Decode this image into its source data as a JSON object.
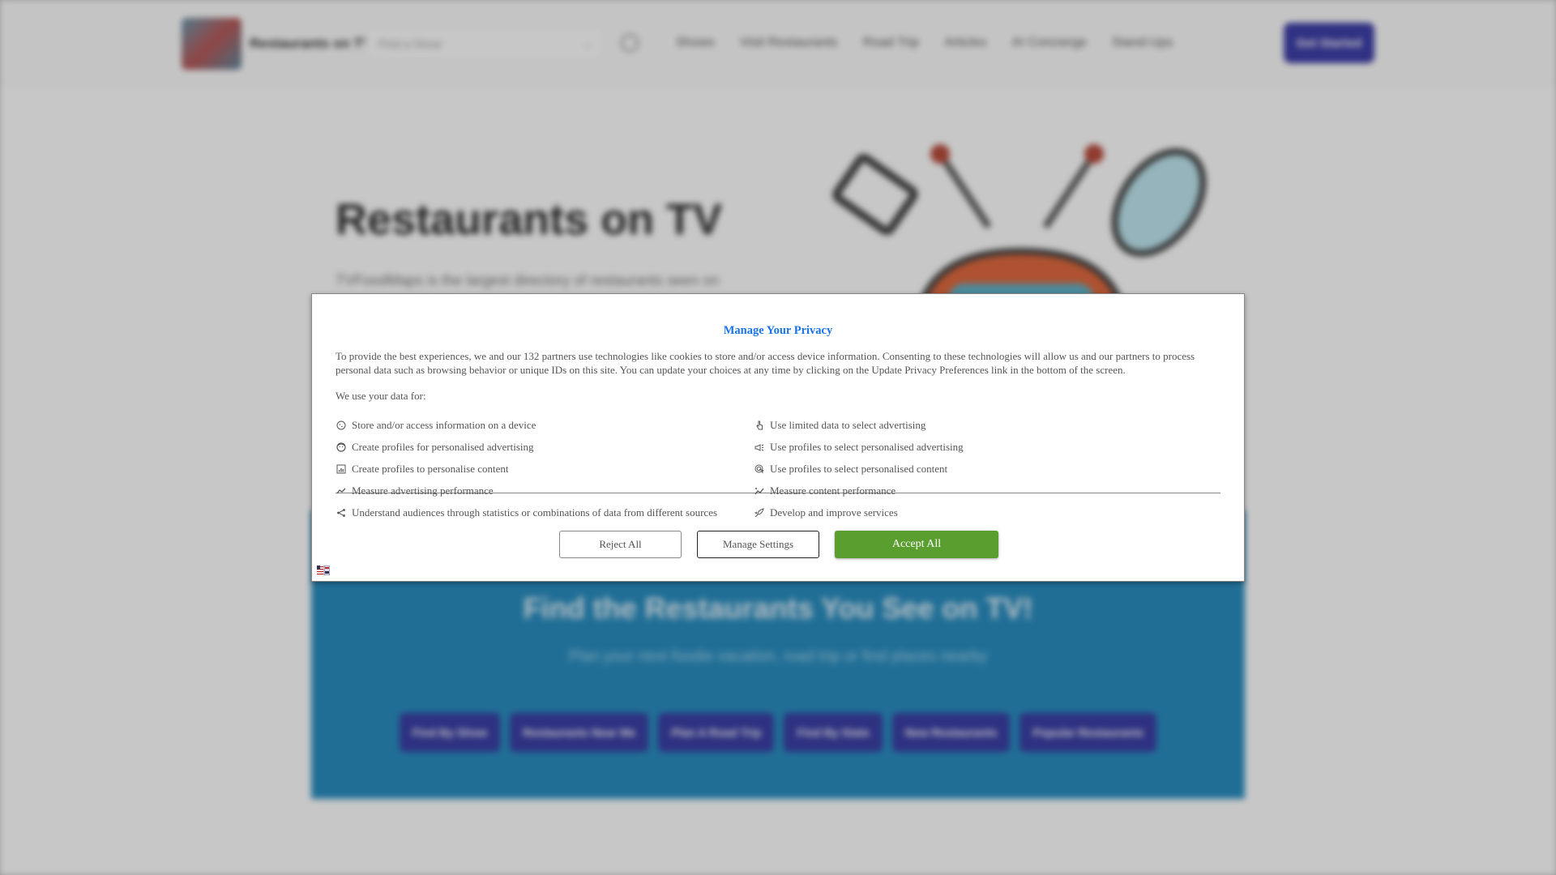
{
  "header": {
    "brand": "Restaurants on TV",
    "search_placeholder": "Find a Show",
    "nav": [
      "Shows",
      "Visit Restaurants",
      "Road Trip",
      "Articles",
      "AI Concierge",
      "Stand-Ups"
    ],
    "cta_label": "Get Started"
  },
  "hero": {
    "title": "Restaurants on TV",
    "subtitle": "TVFoodMaps is the largest directory of restaurants seen on"
  },
  "band": {
    "title": "Find the Restaurants You See on TV!",
    "subtitle": "Plan your next foodie vacation, road trip or find places nearby",
    "buttons": [
      "Find By Show",
      "Restaurants Near Me",
      "Plan A Road Trip",
      "Find By State",
      "New Restaurants",
      "Popular Restaurants"
    ],
    "color": "#2a8ec1"
  },
  "consent": {
    "title": "Manage Your Privacy",
    "description": "To provide the best experiences, we and our 132 partners use technologies like cookies to store and/or access device information. Consenting to these technologies will allow us and our partners to process personal data such as browsing behavior or unique IDs on this site. You can update your choices at any time by clicking on the Update Privacy Preferences link in the bottom of the screen.",
    "uses_label": "We use your data for:",
    "purposes_left": [
      {
        "icon": "cookie-icon",
        "label": "Store and/or access information on a device"
      },
      {
        "icon": "profile-face-icon",
        "label": "Create profiles for personalised advertising"
      },
      {
        "icon": "chart-box-icon",
        "label": "Create profiles to personalise content"
      },
      {
        "icon": "trend-line-icon",
        "label": "Measure advertising performance"
      },
      {
        "icon": "share-icon",
        "label": "Understand audiences through statistics or combinations of data from different sources"
      }
    ],
    "purposes_right": [
      {
        "icon": "pointer-hand-icon",
        "label": "Use limited data to select advertising"
      },
      {
        "icon": "megaphone-icon",
        "label": "Use profiles to select personalised advertising"
      },
      {
        "icon": "target-cursor-icon",
        "label": "Use profiles to select personalised content"
      },
      {
        "icon": "sparkle-trend-icon",
        "label": "Measure content performance"
      },
      {
        "icon": "rocket-icon",
        "label": "Develop and improve services"
      }
    ],
    "buttons": {
      "reject": "Reject All",
      "manage": "Manage Settings",
      "accept": "Accept All"
    },
    "title_color": "#1a73e8",
    "accept_color": "#5a9e2f",
    "language_icon": "us-flag-icon"
  }
}
